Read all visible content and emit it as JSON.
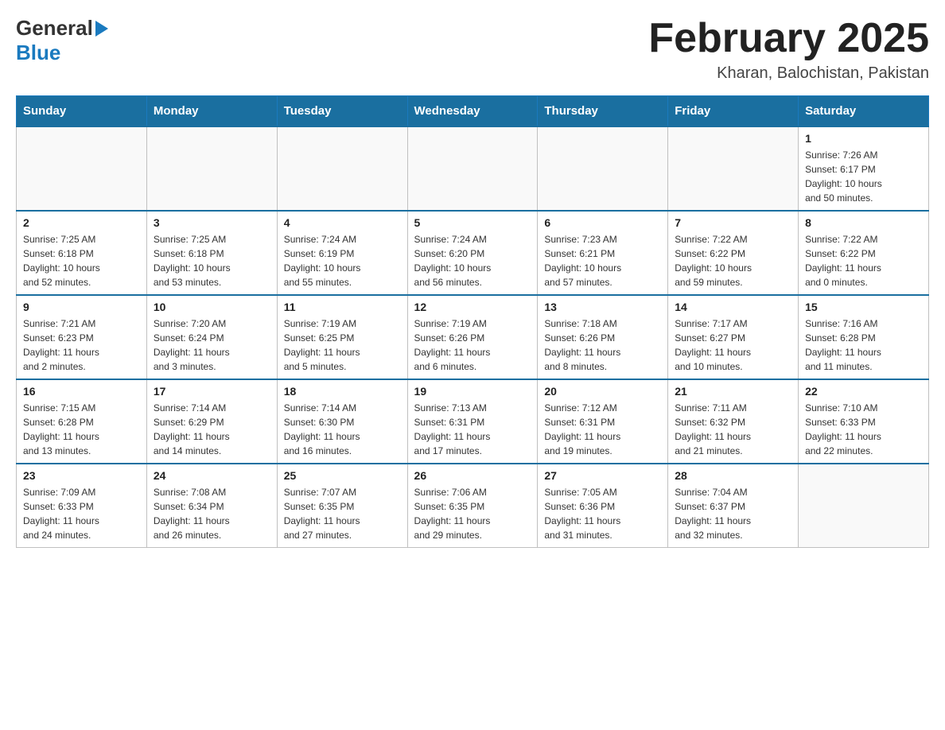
{
  "header": {
    "logo_general": "General",
    "logo_blue": "Blue",
    "month_title": "February 2025",
    "location": "Kharan, Balochistan, Pakistan"
  },
  "days_of_week": [
    "Sunday",
    "Monday",
    "Tuesday",
    "Wednesday",
    "Thursday",
    "Friday",
    "Saturday"
  ],
  "weeks": [
    {
      "days": [
        {
          "num": "",
          "info": ""
        },
        {
          "num": "",
          "info": ""
        },
        {
          "num": "",
          "info": ""
        },
        {
          "num": "",
          "info": ""
        },
        {
          "num": "",
          "info": ""
        },
        {
          "num": "",
          "info": ""
        },
        {
          "num": "1",
          "info": "Sunrise: 7:26 AM\nSunset: 6:17 PM\nDaylight: 10 hours\nand 50 minutes."
        }
      ]
    },
    {
      "days": [
        {
          "num": "2",
          "info": "Sunrise: 7:25 AM\nSunset: 6:18 PM\nDaylight: 10 hours\nand 52 minutes."
        },
        {
          "num": "3",
          "info": "Sunrise: 7:25 AM\nSunset: 6:18 PM\nDaylight: 10 hours\nand 53 minutes."
        },
        {
          "num": "4",
          "info": "Sunrise: 7:24 AM\nSunset: 6:19 PM\nDaylight: 10 hours\nand 55 minutes."
        },
        {
          "num": "5",
          "info": "Sunrise: 7:24 AM\nSunset: 6:20 PM\nDaylight: 10 hours\nand 56 minutes."
        },
        {
          "num": "6",
          "info": "Sunrise: 7:23 AM\nSunset: 6:21 PM\nDaylight: 10 hours\nand 57 minutes."
        },
        {
          "num": "7",
          "info": "Sunrise: 7:22 AM\nSunset: 6:22 PM\nDaylight: 10 hours\nand 59 minutes."
        },
        {
          "num": "8",
          "info": "Sunrise: 7:22 AM\nSunset: 6:22 PM\nDaylight: 11 hours\nand 0 minutes."
        }
      ]
    },
    {
      "days": [
        {
          "num": "9",
          "info": "Sunrise: 7:21 AM\nSunset: 6:23 PM\nDaylight: 11 hours\nand 2 minutes."
        },
        {
          "num": "10",
          "info": "Sunrise: 7:20 AM\nSunset: 6:24 PM\nDaylight: 11 hours\nand 3 minutes."
        },
        {
          "num": "11",
          "info": "Sunrise: 7:19 AM\nSunset: 6:25 PM\nDaylight: 11 hours\nand 5 minutes."
        },
        {
          "num": "12",
          "info": "Sunrise: 7:19 AM\nSunset: 6:26 PM\nDaylight: 11 hours\nand 6 minutes."
        },
        {
          "num": "13",
          "info": "Sunrise: 7:18 AM\nSunset: 6:26 PM\nDaylight: 11 hours\nand 8 minutes."
        },
        {
          "num": "14",
          "info": "Sunrise: 7:17 AM\nSunset: 6:27 PM\nDaylight: 11 hours\nand 10 minutes."
        },
        {
          "num": "15",
          "info": "Sunrise: 7:16 AM\nSunset: 6:28 PM\nDaylight: 11 hours\nand 11 minutes."
        }
      ]
    },
    {
      "days": [
        {
          "num": "16",
          "info": "Sunrise: 7:15 AM\nSunset: 6:28 PM\nDaylight: 11 hours\nand 13 minutes."
        },
        {
          "num": "17",
          "info": "Sunrise: 7:14 AM\nSunset: 6:29 PM\nDaylight: 11 hours\nand 14 minutes."
        },
        {
          "num": "18",
          "info": "Sunrise: 7:14 AM\nSunset: 6:30 PM\nDaylight: 11 hours\nand 16 minutes."
        },
        {
          "num": "19",
          "info": "Sunrise: 7:13 AM\nSunset: 6:31 PM\nDaylight: 11 hours\nand 17 minutes."
        },
        {
          "num": "20",
          "info": "Sunrise: 7:12 AM\nSunset: 6:31 PM\nDaylight: 11 hours\nand 19 minutes."
        },
        {
          "num": "21",
          "info": "Sunrise: 7:11 AM\nSunset: 6:32 PM\nDaylight: 11 hours\nand 21 minutes."
        },
        {
          "num": "22",
          "info": "Sunrise: 7:10 AM\nSunset: 6:33 PM\nDaylight: 11 hours\nand 22 minutes."
        }
      ]
    },
    {
      "days": [
        {
          "num": "23",
          "info": "Sunrise: 7:09 AM\nSunset: 6:33 PM\nDaylight: 11 hours\nand 24 minutes."
        },
        {
          "num": "24",
          "info": "Sunrise: 7:08 AM\nSunset: 6:34 PM\nDaylight: 11 hours\nand 26 minutes."
        },
        {
          "num": "25",
          "info": "Sunrise: 7:07 AM\nSunset: 6:35 PM\nDaylight: 11 hours\nand 27 minutes."
        },
        {
          "num": "26",
          "info": "Sunrise: 7:06 AM\nSunset: 6:35 PM\nDaylight: 11 hours\nand 29 minutes."
        },
        {
          "num": "27",
          "info": "Sunrise: 7:05 AM\nSunset: 6:36 PM\nDaylight: 11 hours\nand 31 minutes."
        },
        {
          "num": "28",
          "info": "Sunrise: 7:04 AM\nSunset: 6:37 PM\nDaylight: 11 hours\nand 32 minutes."
        },
        {
          "num": "",
          "info": ""
        }
      ]
    }
  ]
}
